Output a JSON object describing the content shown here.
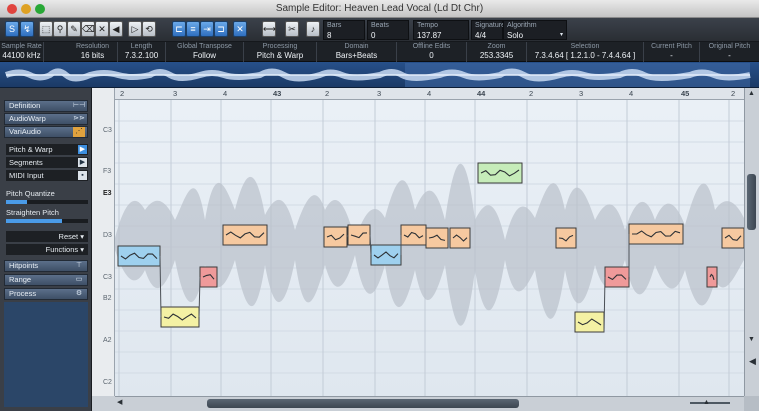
{
  "window": {
    "title": "Sample Editor: Heaven Lead Vocal (Ld Dt Chr)",
    "traffic_lights": [
      "#e0443e",
      "#dea123",
      "#28a836"
    ]
  },
  "toolbar": {
    "icons": [
      "solo-icon",
      "feedback-icon",
      "range-select-icon",
      "zoom-icon",
      "draw-icon",
      "erase-icon",
      "mute-icon",
      "speaker-icon",
      "scrub-icon",
      "play-icon",
      "loop-icon",
      "snap-icon",
      "autoscroll-icon",
      "x-icon",
      "cut-icon",
      "metronome-icon"
    ],
    "fields": [
      {
        "label": "Bars",
        "value": "8"
      },
      {
        "label": "Beats",
        "value": "0"
      },
      {
        "label": "Tempo",
        "value": "137.87"
      },
      {
        "label": "Signature",
        "value": "4/4"
      },
      {
        "label": "Algorithm",
        "value": "Solo"
      }
    ]
  },
  "info": [
    {
      "label": "Sample Rate",
      "value": "44100   kHz"
    },
    {
      "label": "Resolution",
      "value": "16     bits"
    },
    {
      "label": "Length",
      "value": "7.3.2.100"
    },
    {
      "label": "Global Transpose",
      "value": "Follow"
    },
    {
      "label": "Processing",
      "value": "Pitch & Warp"
    },
    {
      "label": "Domain",
      "value": "Bars+Beats"
    },
    {
      "label": "Offline Edits",
      "value": "0"
    },
    {
      "label": "Zoom",
      "value": "253.3345"
    },
    {
      "label": "Selection",
      "value": "7.3.4.64 [ 1.2.1.0 - 7.4.4.64 ]"
    },
    {
      "label": "Current Pitch",
      "value": "-"
    },
    {
      "label": "Original Pitch",
      "value": "-"
    }
  ],
  "sidebar": {
    "sections_top": [
      {
        "label": "Definition",
        "icon": "definition-icon",
        "glyph": "⊢⊣"
      },
      {
        "label": "AudioWarp",
        "icon": "audiowarp-icon",
        "glyph": "⋗⋗"
      },
      {
        "label": "VariAudio",
        "icon": "variaudio-icon",
        "glyph": "⋰"
      }
    ],
    "tools": [
      {
        "label": "Pitch & Warp",
        "icon": "pitch-warp-icon",
        "glyph": "▶",
        "active": true
      },
      {
        "label": "Segments",
        "icon": "segments-icon",
        "glyph": "▶",
        "active": false
      },
      {
        "label": "MIDI Input",
        "icon": "midi-input-icon",
        "glyph": "▪",
        "active": false
      }
    ],
    "pitch_quantize": {
      "label": "Pitch Quantize",
      "level": 0.26
    },
    "straighten_pitch": {
      "label": "Straighten Pitch",
      "level": 0.68
    },
    "reset_label": "Reset",
    "functions_label": "Functions",
    "sections_bottom": [
      {
        "label": "Hitpoints",
        "icon": "hitpoints-icon",
        "glyph": "⊤"
      },
      {
        "label": "Range",
        "icon": "range-icon",
        "glyph": "▭"
      },
      {
        "label": "Process",
        "icon": "process-icon",
        "glyph": "⚙"
      }
    ]
  },
  "keyboard": {
    "labels": [
      "C3",
      "F3",
      "E3",
      "D3",
      "C3",
      "B2",
      "A2",
      "C2"
    ]
  },
  "ruler": {
    "bars": [
      "2",
      "3",
      "4",
      "43",
      "44",
      "45"
    ],
    "sub": [
      "2",
      "3",
      "4",
      "2",
      "3",
      "4",
      "2",
      "3"
    ]
  },
  "colors": {
    "segment_blue": "#9ed0ee",
    "segment_orange": "#f6c9a0",
    "segment_yellow": "#f4f1a4",
    "segment_green": "#c6ecb9",
    "segment_red": "#ef9a9a"
  }
}
